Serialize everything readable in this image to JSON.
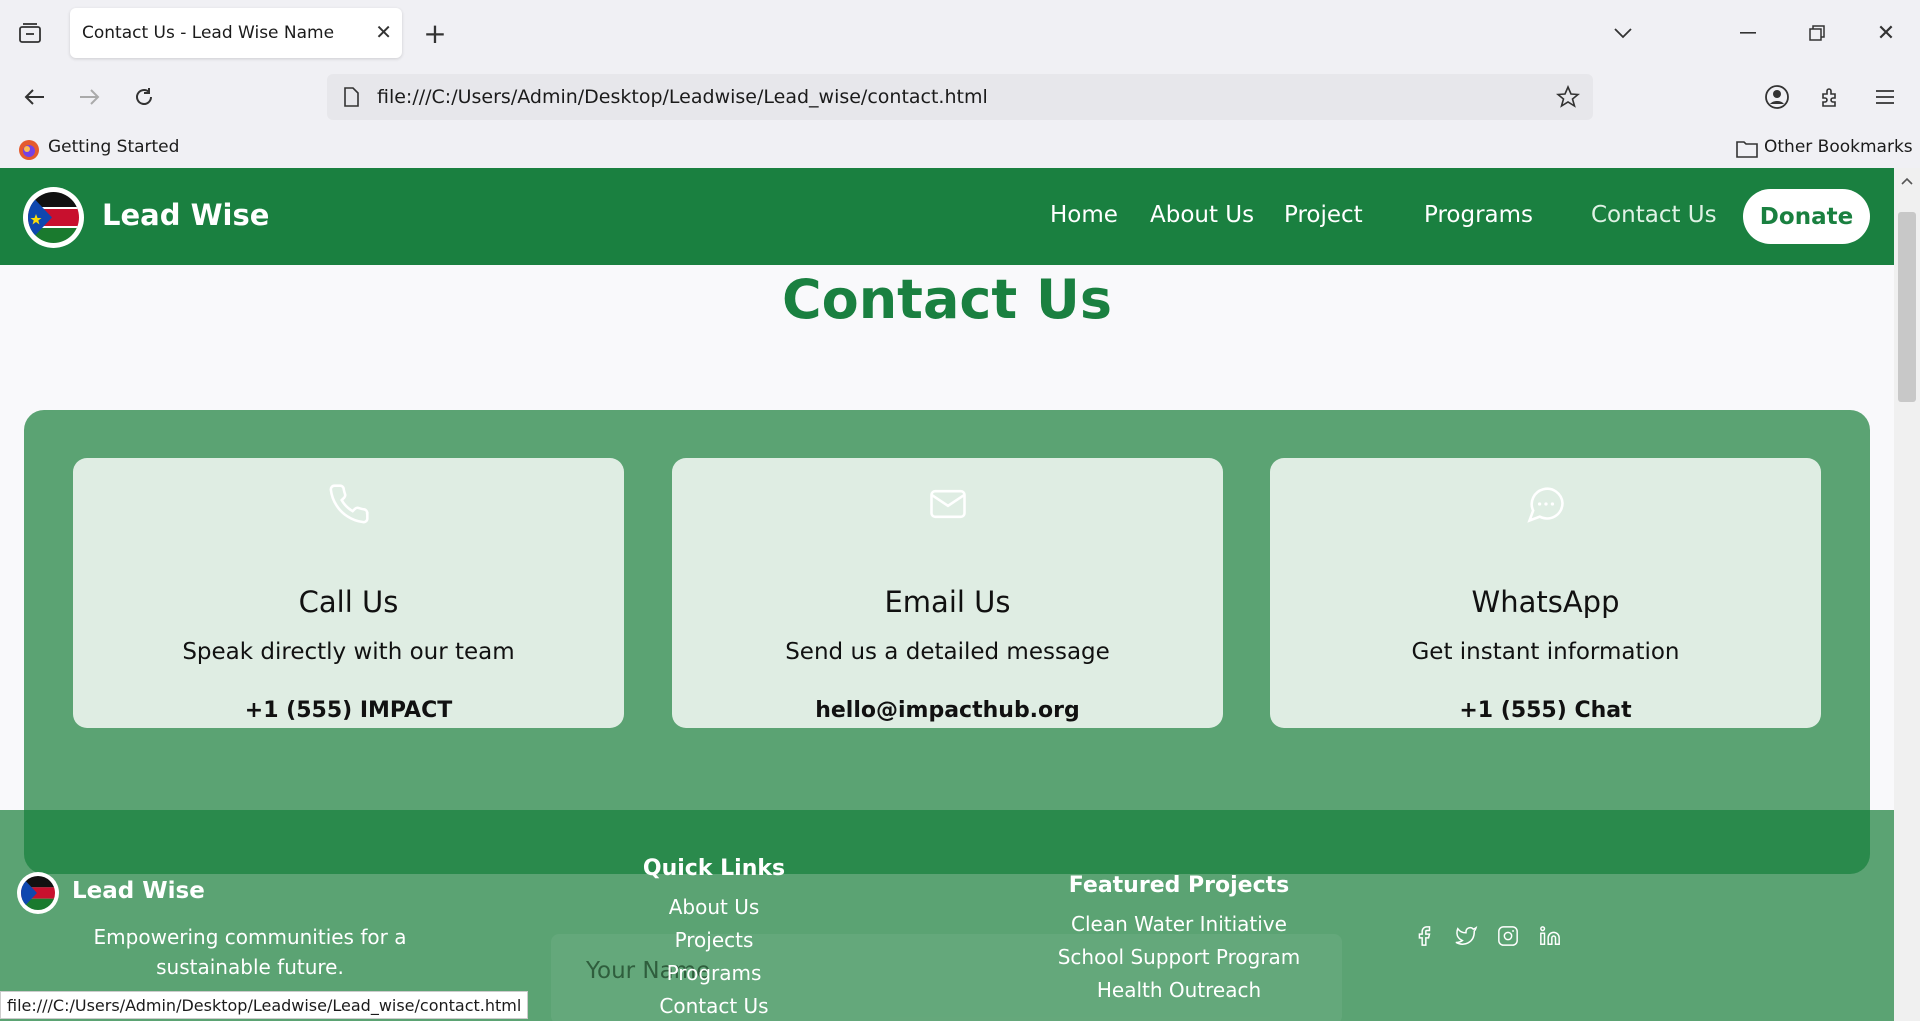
{
  "browser": {
    "tab_title": "Contact Us - Lead Wise Name",
    "url": "file:///C:/Users/Admin/Desktop/Leadwise/Lead_wise/contact.html",
    "bookmark_getting_started": "Getting Started",
    "bookmark_other": "Other Bookmarks",
    "status_url": "file:///C:/Users/Admin/Desktop/Leadwise/Lead_wise/contact.html"
  },
  "nav": {
    "brand": "Lead Wise",
    "links": [
      "Home",
      "About Us",
      "Project",
      "Programs",
      "Contact Us"
    ],
    "donate": "Donate"
  },
  "page": {
    "title": "Contact Us"
  },
  "cards": [
    {
      "icon": "phone-icon",
      "title": "Call Us",
      "desc": "Speak directly with our team",
      "contact": "+1 (555) IMPACT"
    },
    {
      "icon": "mail-icon",
      "title": "Email Us",
      "desc": "Send us a detailed message",
      "contact": "hello@impacthub.org"
    },
    {
      "icon": "chat-icon",
      "title": "WhatsApp",
      "desc": "Get instant information",
      "contact": "+1 (555) Chat"
    }
  ],
  "footer": {
    "brand": "Lead Wise",
    "tagline": "Empowering communities for a sustainable future.",
    "quick_links_title": "Quick Links",
    "quick_links": [
      "About Us",
      "Projects",
      "Programs",
      "Contact Us"
    ],
    "featured_title": "Featured Projects",
    "featured": [
      "Clean Water Initiative",
      "School Support Program",
      "Health Outreach"
    ],
    "form_placeholder": "Your Name"
  },
  "colors": {
    "brand_green": "#1a8040",
    "panel_green": "#5ba373",
    "card_bg": "#dfede3"
  }
}
